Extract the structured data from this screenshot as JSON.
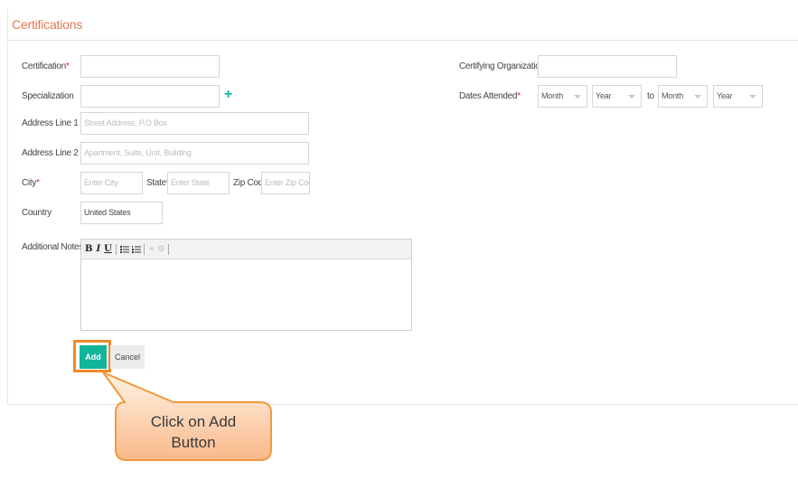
{
  "section": {
    "title": "Certifications"
  },
  "form": {
    "certification": {
      "label": "Certification",
      "required": "*",
      "value": ""
    },
    "specialization": {
      "label": "Specialization",
      "value": "",
      "add_icon": "+"
    },
    "address1": {
      "label": "Address Line 1",
      "placeholder": "Street Address, P.O Box"
    },
    "address2": {
      "label": "Address Line 2",
      "placeholder": "Apartment, Suite, Unit, Building"
    },
    "city": {
      "label": "City",
      "required": "*",
      "placeholder": "Enter City"
    },
    "state": {
      "label": "State",
      "required": "*",
      "placeholder": "Enter State"
    },
    "zip": {
      "label": "Zip Code",
      "placeholder": "Enter Zip Code"
    },
    "country": {
      "label": "Country",
      "value": "United States"
    },
    "notes": {
      "label": "Additional Notes"
    },
    "organization": {
      "label": "Certifying Organization",
      "required": "*",
      "value": ""
    },
    "dates": {
      "label": "Dates Attended",
      "required": "*",
      "from_month": "Month",
      "from_year": "Year",
      "to_label": "to",
      "to_month": "Month",
      "to_year": "Year"
    }
  },
  "editor_toolbar": {
    "bold": "B",
    "italic": "I",
    "underline": "U",
    "icons": [
      "bullet-list-icon",
      "numbered-list-icon",
      "link-icon",
      "unlink-icon"
    ]
  },
  "buttons": {
    "add": "Add",
    "cancel": "Cancel"
  },
  "callout": {
    "line1": "Click on Add",
    "line2": "Button"
  },
  "colors": {
    "accent": "#12b59a",
    "highlight": "#ee8a2a",
    "title": "#e07a55",
    "required": "#d9262d"
  }
}
